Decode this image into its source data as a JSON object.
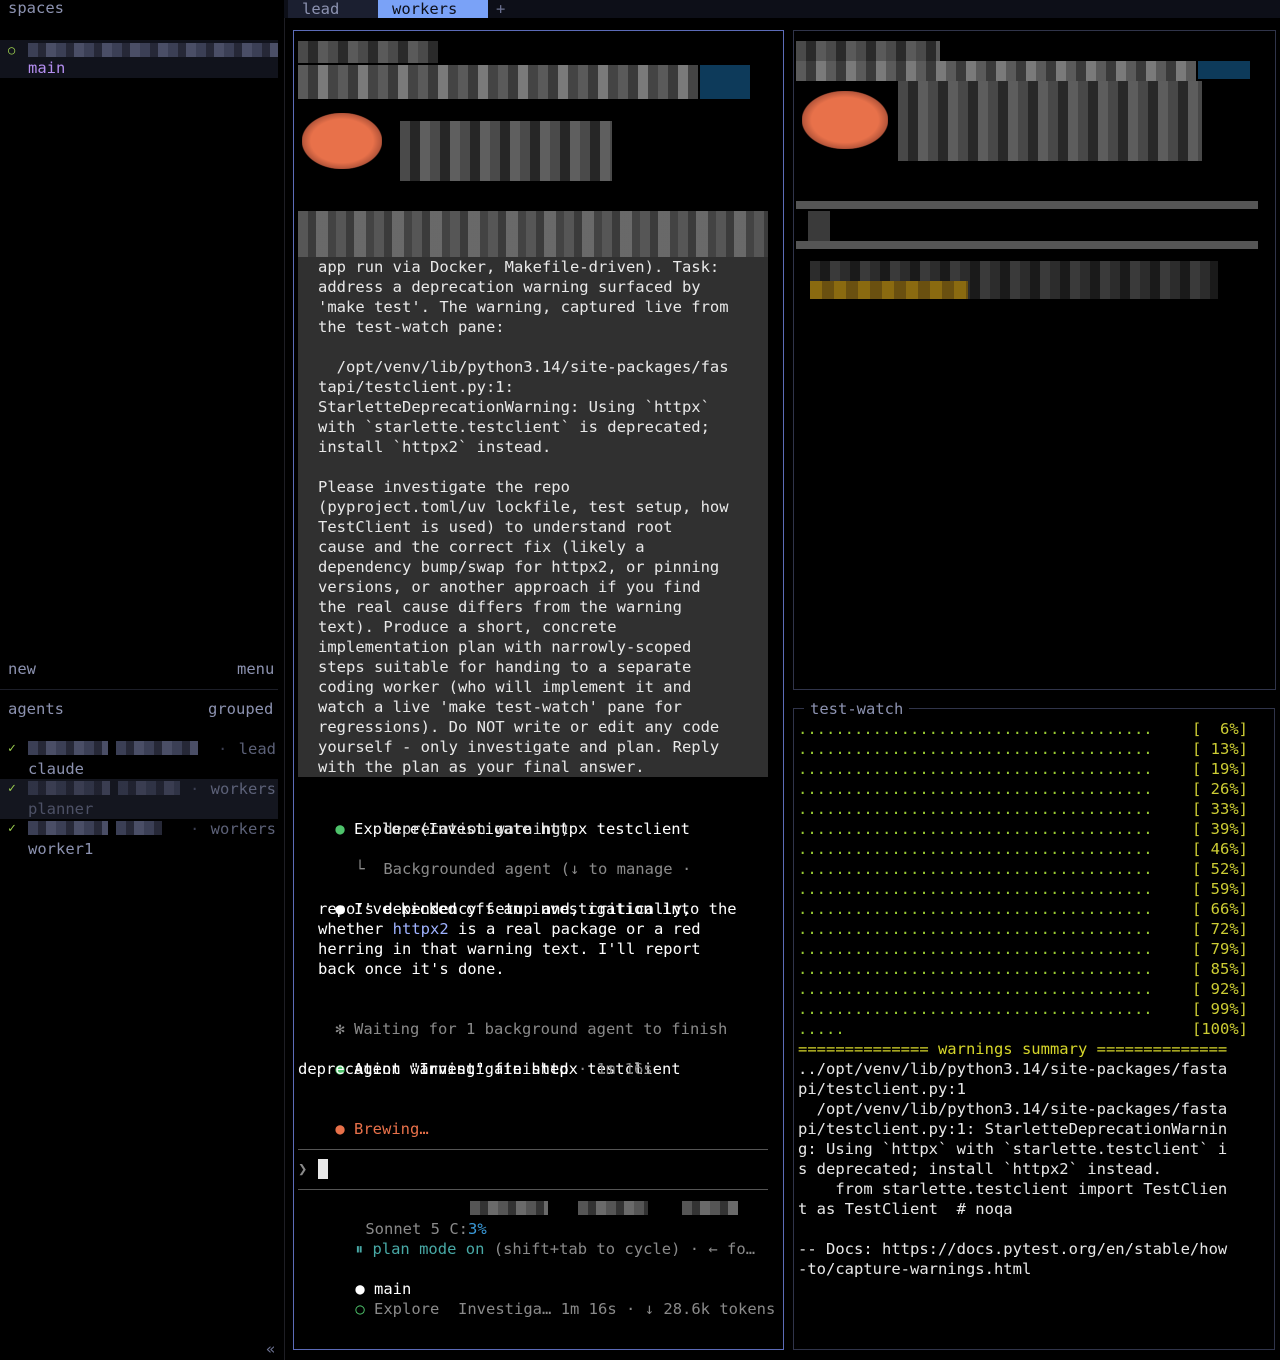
{
  "sidebar": {
    "spaces_label": "spaces",
    "space_item": "main",
    "new_label": "new",
    "menu_label": "menu",
    "agents_label": "agents",
    "grouped_label": "grouped",
    "agents": [
      {
        "name": "claude",
        "space": "lead",
        "status": "✓"
      },
      {
        "name": "planner",
        "space": "workers",
        "status": "✓"
      },
      {
        "name": "worker1",
        "space": "workers",
        "status": "✓"
      }
    ],
    "collapse_label": "«"
  },
  "tabs": {
    "items": [
      {
        "label": "lead"
      },
      {
        "label": "workers"
      }
    ],
    "add_label": "+"
  },
  "left_pane": {
    "prompt_lines": [
      "app run via Docker, Makefile-driven). Task:",
      "address a deprecation warning surfaced by",
      "'make test'. The warning, captured live from",
      "the test-watch pane:",
      "",
      "  /opt/venv/lib/python3.14/site-packages/fas",
      "tapi/testclient.py:1:",
      "StarletteDeprecationWarning: Using `httpx`",
      "with `starlette.testclient` is deprecated;",
      "install `httpx2` instead.",
      "",
      "Please investigate the repo",
      "(pyproject.toml/uv lockfile, test setup, how",
      "TestClient is used) to understand root",
      "cause and the correct fix (likely a",
      "dependency bump/swap for httpx2, or pinning",
      "versions, or another approach if you find",
      "the real cause differs from the warning",
      "text). Produce a short, concrete",
      "implementation plan with narrowly-scoped",
      "steps suitable for handing to a separate",
      "coding worker (who will implement it and",
      "watch a live 'make test-watch' pane for",
      "regressions). Do NOT write or edit any code",
      "yourself - only investigate and plan. Reply",
      "with the plan as your final answer."
    ],
    "explore_line1": "Explore(Investigate httpx testclient",
    "explore_line2": "       deprecation warning)",
    "explore_sub": "Backgrounded agent (↓ to manage ·",
    "reply_line1": "I've kicked off an investigation into the",
    "reply_line2": "repo's dependency setup and, critically,",
    "reply_line3_pre": "whether ",
    "reply_line3_code": "httpx2",
    "reply_line3_post": " is a real package or a red",
    "reply_line4": "herring in that warning text. I'll report",
    "reply_line5": "back once it's done.",
    "waiting_text": "Waiting for 1 background agent to finish",
    "finished_line1": "Agent \"Investigate httpx testclient",
    "finished_line2": "deprecation warning\" finished",
    "finished_time": " · 1m 16s",
    "brewing": "Brewing…",
    "prompt_char": "❯",
    "model_label": "Sonnet 5",
    "context_label": "C:",
    "context_value": "3%",
    "plan_mode_icon": "⏸",
    "plan_mode_label": "plan mode on",
    "plan_mode_hint": "(shift+tab to cycle) · ← fo…",
    "task_main": "main",
    "task_explore": "Explore",
    "task_desc": "Investiga…",
    "task_time": "1m 16s",
    "task_tokens": "· ↓ 28.6k tokens",
    "colors": {
      "accent": "#7aa2f7",
      "green": "#4ec36b",
      "brewing": "#e8714a"
    }
  },
  "watch_pane": {
    "title": "test-watch",
    "progress_rows": [
      {
        "dots": "......................................",
        "pct": "[  6%]"
      },
      {
        "dots": "......................................",
        "pct": "[ 13%]"
      },
      {
        "dots": "......................................",
        "pct": "[ 19%]"
      },
      {
        "dots": "......................................",
        "pct": "[ 26%]"
      },
      {
        "dots": "......................................",
        "pct": "[ 33%]"
      },
      {
        "dots": "......................................",
        "pct": "[ 39%]"
      },
      {
        "dots": "......................................",
        "pct": "[ 46%]"
      },
      {
        "dots": "......................................",
        "pct": "[ 52%]"
      },
      {
        "dots": "......................................",
        "pct": "[ 59%]"
      },
      {
        "dots": "......................................",
        "pct": "[ 66%]"
      },
      {
        "dots": "......................................",
        "pct": "[ 72%]"
      },
      {
        "dots": "......................................",
        "pct": "[ 79%]"
      },
      {
        "dots": "......................................",
        "pct": "[ 85%]"
      },
      {
        "dots": "......................................",
        "pct": "[ 92%]"
      },
      {
        "dots": "......................................",
        "pct": "[ 99%]"
      },
      {
        "dots": ".....",
        "pct": "[100%]"
      }
    ],
    "summary_header": "============== warnings summary ==============",
    "output_lines": [
      "../opt/venv/lib/python3.14/site-packages/fasta",
      "pi/testclient.py:1",
      "  /opt/venv/lib/python3.14/site-packages/fasta",
      "pi/testclient.py:1: StarletteDeprecationWarnin",
      "g: Using `httpx` with `starlette.testclient` i",
      "s deprecated; install `httpx2` instead.",
      "    from starlette.testclient import TestClien",
      "t as TestClient  # noqa",
      "",
      "-- Docs: https://docs.pytest.org/en/stable/how",
      "-to/capture-warnings.html"
    ]
  }
}
